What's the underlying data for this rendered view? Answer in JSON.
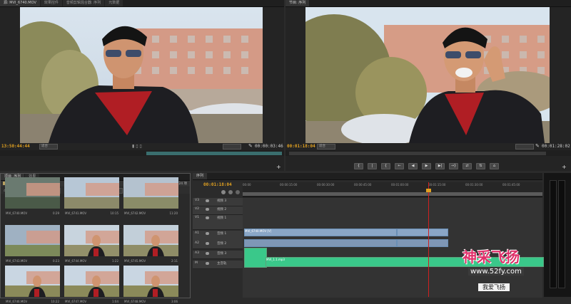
{
  "source_monitor": {
    "tabs": [
      "源: MVI_6740.MOV",
      "效果控件",
      "音频剪辑混合器: 序列",
      "元数据"
    ],
    "timecode": "13:50:44:44",
    "fit": "适合",
    "duration": "00:00:03:46"
  },
  "program_monitor": {
    "tabs": [
      "节目: 序列"
    ],
    "timecode": "00:01:18:04",
    "fit": "适合",
    "duration": "00:01:28:02",
    "controls": [
      "{",
      "|",
      "{",
      "←",
      "◀",
      "▶",
      "▶|",
      "→}",
      "⇄",
      "⇅",
      "⌂"
    ]
  },
  "project": {
    "tabs": [
      "项目: 序列",
      "效果"
    ],
    "path": "序列.prproj",
    "item_count": "224 项",
    "entry_label": "入口:",
    "entry_value": "全部",
    "items": [
      {
        "name": "MVI_6740.MOV",
        "dur": "0:29"
      },
      {
        "name": "MVI_6741.MOV",
        "dur": "10:15"
      },
      {
        "name": "MVI_6742.MOV",
        "dur": "11:20"
      },
      {
        "name": "MVI_6743.MOV",
        "dur": "0:23"
      },
      {
        "name": "MVI_6744.MOV",
        "dur": "1:22"
      },
      {
        "name": "MVI_6745.MOV",
        "dur": "2:11"
      },
      {
        "name": "MVI_6746.MOV",
        "dur": "10:22"
      },
      {
        "name": "MVI_6747.MOV",
        "dur": "1:04"
      },
      {
        "name": "MVI_6748.MOV",
        "dur": "3:06"
      }
    ]
  },
  "timeline": {
    "tab": "序列",
    "timecode": "00:01:18:04",
    "ruler": [
      "00:00",
      "00:00:15:00",
      "00:00:30:00",
      "00:00:45:00",
      "00:01:00:00",
      "00:01:15:00",
      "00:01:30:00",
      "00:01:45:00"
    ],
    "tracks": [
      {
        "id": "V3",
        "name": "视频 3"
      },
      {
        "id": "V2",
        "name": "视频 2"
      },
      {
        "id": "V1",
        "name": "视频 1"
      },
      {
        "id": "A1",
        "name": "音频 1"
      },
      {
        "id": "A2",
        "name": "音频 2"
      },
      {
        "id": "A3",
        "name": "音频 3"
      },
      {
        "id": "M",
        "name": "主音轨"
      }
    ],
    "v1_clip_label": "MVI_6740.MOV [V]",
    "a1_clip_label": "MVI_1.1.mp3"
  },
  "watermark": {
    "title": "神采飞扬",
    "url": "www.52fy.com",
    "sub": "我爱飞扬"
  },
  "colors": {
    "accent_timecode": "#e0a020",
    "playhead": "#d02020",
    "video_clip": "#8aa6c6",
    "audio_clip": "#79b98f",
    "wm_pink": "#e0306a"
  }
}
